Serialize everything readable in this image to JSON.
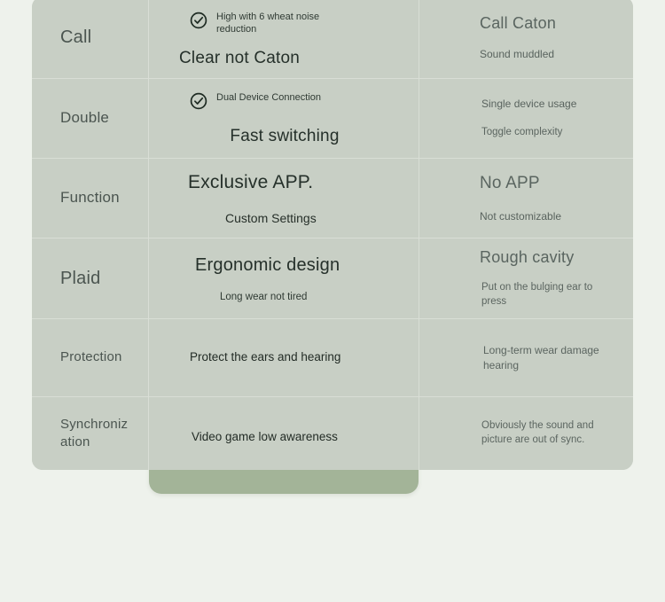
{
  "theme": {
    "page_background": "#eef2ec",
    "table_background": "#c8cfc5",
    "highlight_column_background": "#a3b498",
    "divider": "#d9ded6",
    "feature_text": "#4b5550",
    "ours_text": "#25302a",
    "theirs_text": "#5a6560"
  },
  "icons": {
    "check": "check-circle-icon"
  },
  "rows": [
    {
      "feature": "Call",
      "feature_size": "lg",
      "ours": {
        "check_label": "High with 6 wheat noise reduction",
        "headline": "Clear not Caton"
      },
      "theirs": {
        "headline": "Call Caton",
        "sub": "Sound muddled"
      }
    },
    {
      "feature": "Double",
      "feature_size": "md",
      "ours": {
        "check_label": "Dual Device Connection",
        "headline": "Fast switching"
      },
      "theirs": {
        "sub": "Single device usage",
        "sub2": "Toggle complexity"
      }
    },
    {
      "feature": "Function",
      "feature_size": "md",
      "ours": {
        "headline": "Exclusive APP.",
        "sub": "Custom Settings"
      },
      "theirs": {
        "headline": "No APP",
        "sub": "Not customizable"
      }
    },
    {
      "feature": "Plaid",
      "feature_size": "lg",
      "ours": {
        "headline": "Ergonomic design",
        "sub": "Long wear not tired"
      },
      "theirs": {
        "headline": "Rough cavity",
        "body": "Put on the bulging ear to press"
      }
    },
    {
      "feature": "Protection",
      "feature_size": "sm",
      "ours": {
        "body": "Protect the ears and hearing"
      },
      "theirs": {
        "body": "Long-term wear damage hearing"
      }
    },
    {
      "feature": "Synchronization",
      "feature_size": "sm",
      "ours": {
        "body": "Video game low awareness"
      },
      "theirs": {
        "body": "Obviously the sound and picture are out of sync."
      }
    }
  ]
}
